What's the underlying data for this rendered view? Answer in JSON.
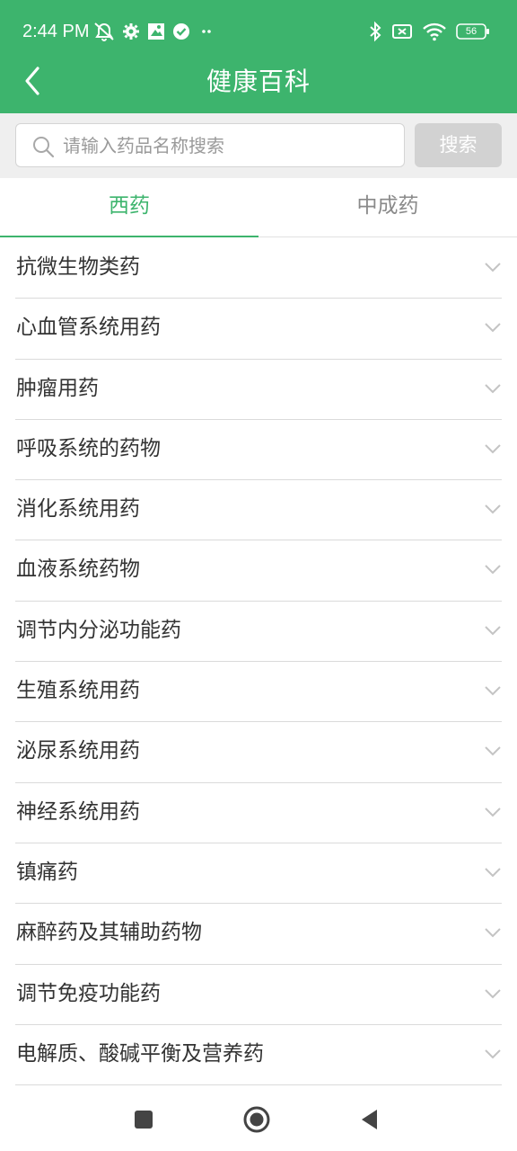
{
  "status_bar": {
    "time": "2:44 PM",
    "battery": "56"
  },
  "header": {
    "title": "健康百科"
  },
  "search": {
    "placeholder": "请输入药品名称搜索",
    "value": "",
    "button_label": "搜索"
  },
  "tabs": [
    {
      "label": "西药",
      "active": true
    },
    {
      "label": "中成药",
      "active": false
    }
  ],
  "categories": [
    {
      "label": "抗微生物类药"
    },
    {
      "label": "心血管系统用药"
    },
    {
      "label": "肿瘤用药"
    },
    {
      "label": "呼吸系统的药物"
    },
    {
      "label": "消化系统用药"
    },
    {
      "label": "血液系统药物"
    },
    {
      "label": "调节内分泌功能药"
    },
    {
      "label": "生殖系统用药"
    },
    {
      "label": "泌尿系统用药"
    },
    {
      "label": "神经系统用药"
    },
    {
      "label": "镇痛药"
    },
    {
      "label": "麻醉药及其辅助药物"
    },
    {
      "label": "调节免疫功能药"
    },
    {
      "label": "电解质、酸碱平衡及营养药"
    }
  ],
  "colors": {
    "brand_green": "#3DB46D",
    "inactive_tab": "#8A8A8A",
    "search_button": "#D2D2D2"
  },
  "icons": {
    "back": "chevron-left-icon",
    "search": "magnifier-icon",
    "expand": "chevron-down-icon",
    "nav_recents": "square-icon",
    "nav_home": "circle-icon",
    "nav_back": "triangle-left-icon"
  }
}
